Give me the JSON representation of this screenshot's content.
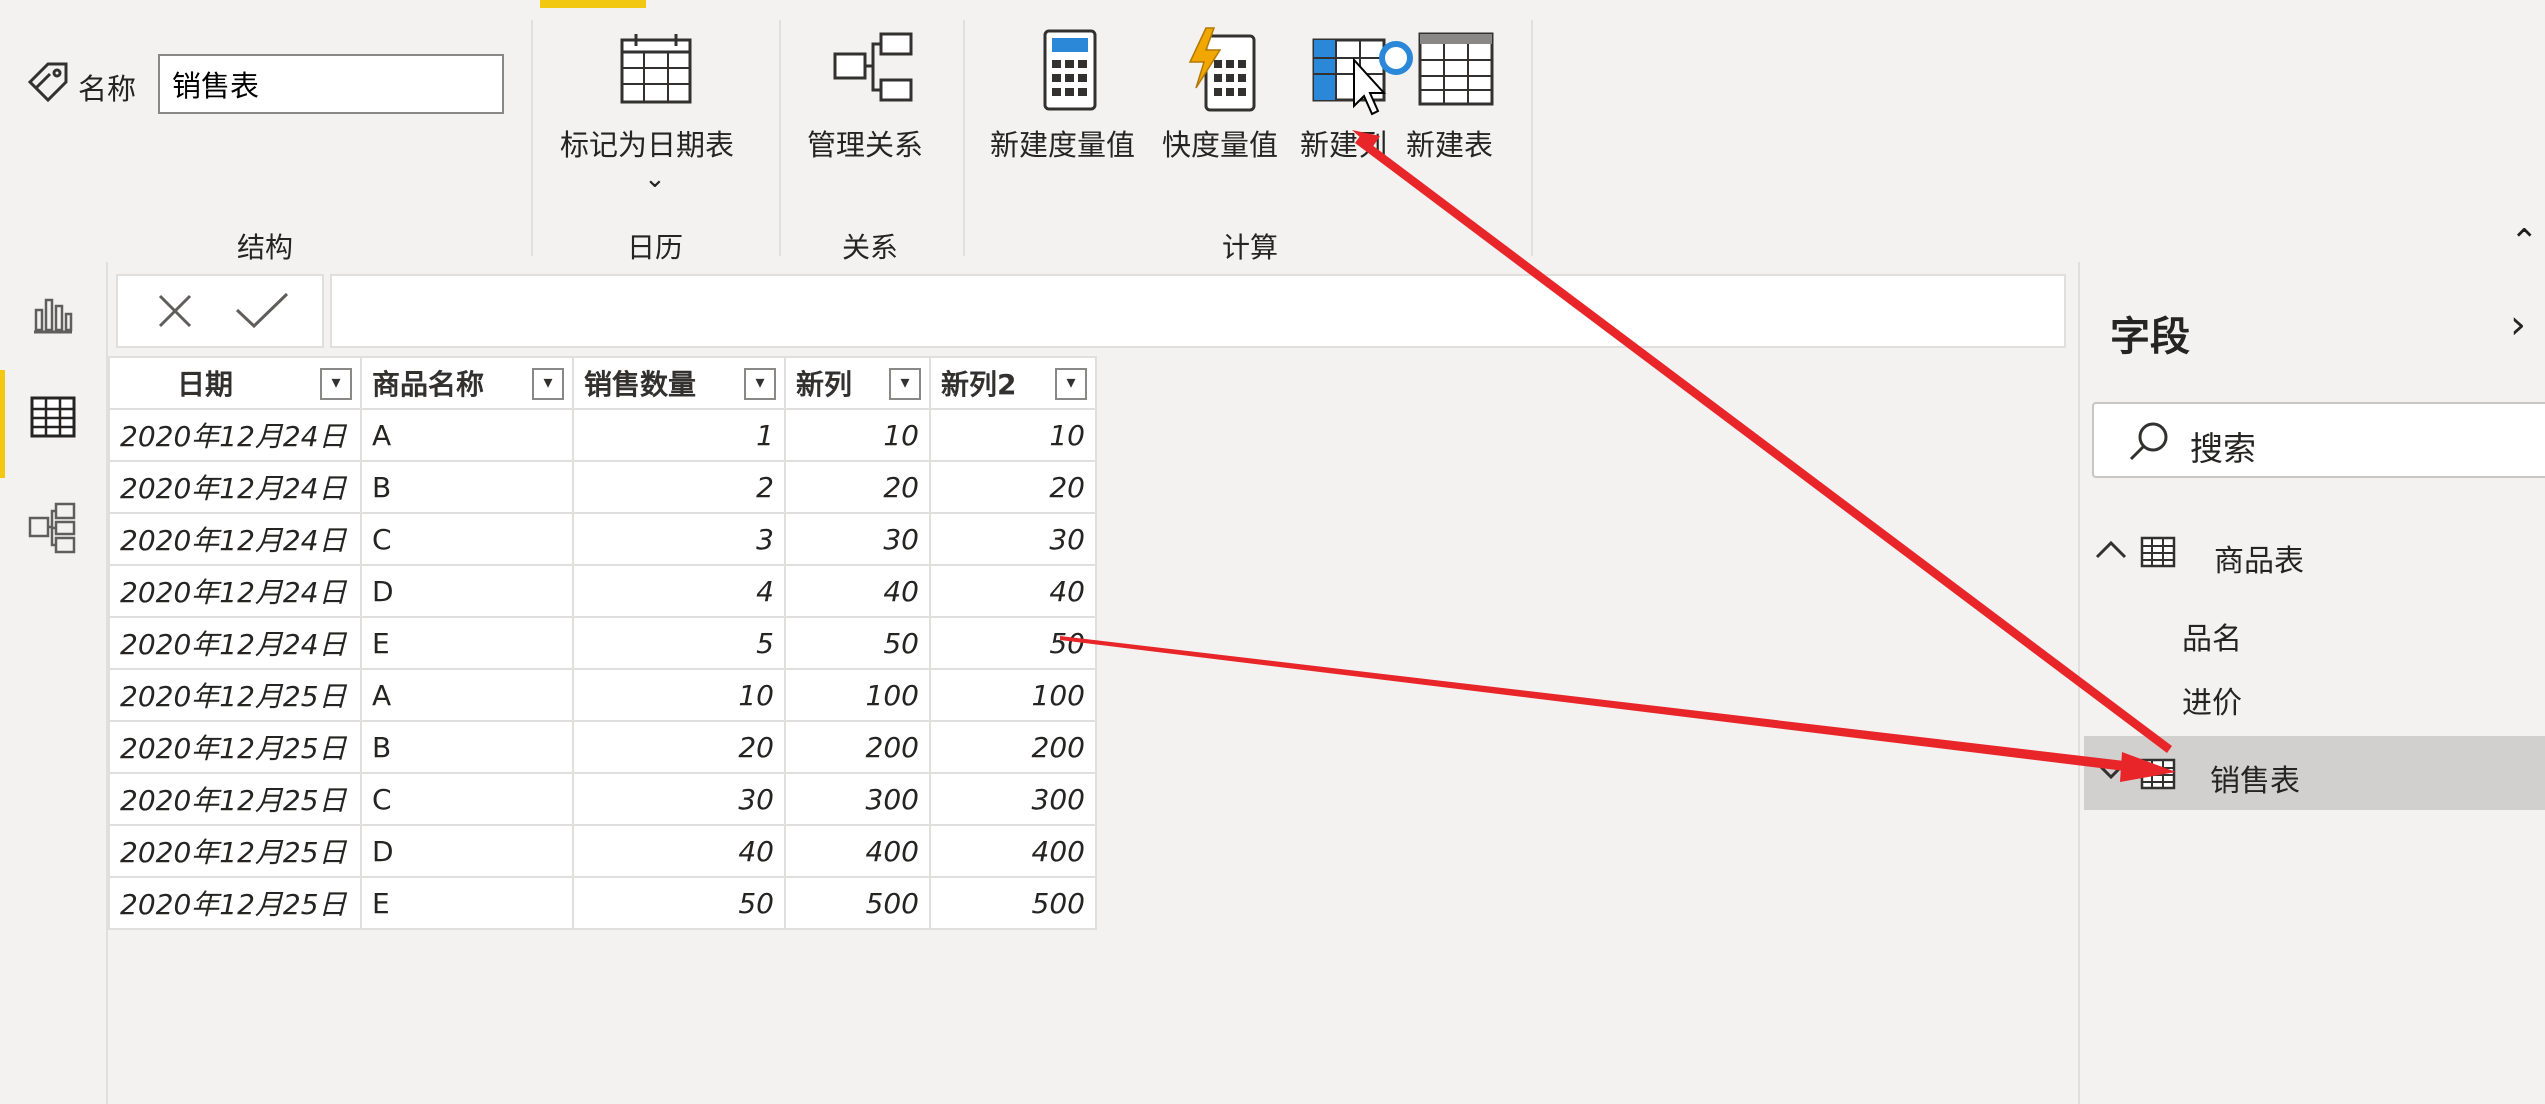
{
  "ribbon": {
    "structure": {
      "name_label": "名称",
      "name_value": "销售表",
      "group_label": "结构"
    },
    "calendar": {
      "mark_date_table": "标记为日期表",
      "group_label": "日历"
    },
    "relations": {
      "manage": "管理关系",
      "group_label": "关系"
    },
    "calc": {
      "new_measure": "新建度量值",
      "quick_measure": "快度量值",
      "new_column": "新建列",
      "new_table": "新建表",
      "group_label": "计算"
    }
  },
  "left_nav": {
    "icons": [
      "report-view-icon",
      "data-view-icon",
      "model-view-icon"
    ],
    "active_index": 1
  },
  "formula_bar": {
    "cancel_icon": "close-icon",
    "commit_icon": "checkmark-icon",
    "value": ""
  },
  "table": {
    "columns": [
      "日期",
      "商品名称",
      "销售数量",
      "新列",
      "新列2"
    ],
    "rows": [
      [
        "2020年12月24日",
        "A",
        "1",
        "10",
        "10"
      ],
      [
        "2020年12月24日",
        "B",
        "2",
        "20",
        "20"
      ],
      [
        "2020年12月24日",
        "C",
        "3",
        "30",
        "30"
      ],
      [
        "2020年12月24日",
        "D",
        "4",
        "40",
        "40"
      ],
      [
        "2020年12月24日",
        "E",
        "5",
        "50",
        "50"
      ],
      [
        "2020年12月25日",
        "A",
        "10",
        "100",
        "100"
      ],
      [
        "2020年12月25日",
        "B",
        "20",
        "200",
        "200"
      ],
      [
        "2020年12月25日",
        "C",
        "30",
        "300",
        "300"
      ],
      [
        "2020年12月25日",
        "D",
        "40",
        "400",
        "400"
      ],
      [
        "2020年12月25日",
        "E",
        "50",
        "500",
        "500"
      ]
    ]
  },
  "fields_pane": {
    "title": "字段",
    "search_placeholder": "搜索",
    "tables": [
      {
        "name": "商品表",
        "expanded": true,
        "fields": [
          "品名",
          "进价"
        ]
      },
      {
        "name": "销售表",
        "expanded": false,
        "selected": true
      }
    ]
  },
  "colors": {
    "accent": "#f2c811",
    "annotation_arrow": "#e8262a",
    "selected_row": "#d2d0ce",
    "icon_blue": "#2b88d8"
  }
}
